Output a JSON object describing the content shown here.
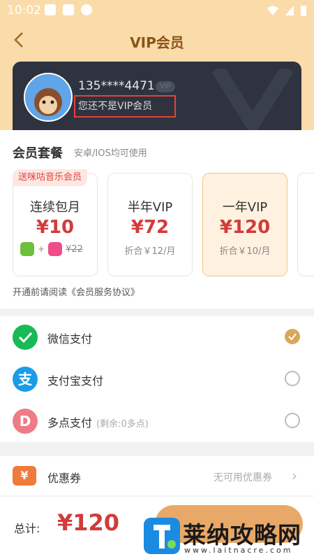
{
  "status_bar": {
    "time": "10:02"
  },
  "header": {
    "title": "VIP会员",
    "back_icon": "chevron-left-icon"
  },
  "profile": {
    "phone": "135****4471",
    "vip_badge": "VIP",
    "status_text": "您还不是VIP会员"
  },
  "plans_section": {
    "title": "会员套餐",
    "subtitle": "安卓/IOS均可使用",
    "gift_tag": "送咪咕音乐会员",
    "plans": [
      {
        "name": "连续包月",
        "price": "¥10",
        "note_original": "¥22",
        "selected": false
      },
      {
        "name": "半年VIP",
        "price": "¥72",
        "note": "折合￥12/月",
        "selected": false
      },
      {
        "name": "一年VIP",
        "price": "¥120",
        "note": "折合￥10/月",
        "selected": true
      }
    ],
    "agreement": "开通前请阅读《会员服务协议》"
  },
  "payments": [
    {
      "label": "微信支付",
      "sub": "",
      "icon": "wechat-pay-icon",
      "color": "#19b955",
      "selected": true
    },
    {
      "label": "支付宝支付",
      "sub": "",
      "icon": "alipay-icon",
      "color": "#1b9ce8",
      "selected": false
    },
    {
      "label": "多点支付",
      "sub": "(剩余:0多点)",
      "icon": "duodian-icon",
      "color": "#ee7c86",
      "selected": false
    }
  ],
  "coupon": {
    "label": "优惠券",
    "value": "无可用优惠券"
  },
  "footer": {
    "total_label": "总计:",
    "total_price": "¥120"
  },
  "watermark": {
    "text": "莱纳攻略网",
    "url": "www.laitnacre.com"
  },
  "colors": {
    "header_bg": "#fadcaa",
    "accent": "#d23b3b",
    "selected_radio": "#d9a75b"
  }
}
